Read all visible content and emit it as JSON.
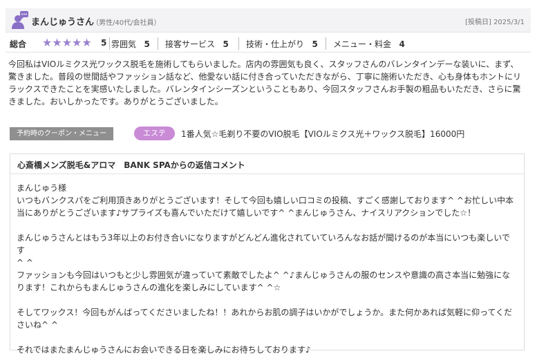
{
  "header": {
    "username": "まんじゅうさん",
    "user_attributes": "（男性/40代/会社員）",
    "posted_label": "[投稿日] 2025/3/1"
  },
  "ratings": {
    "overall_label": "総合",
    "overall_value": "5",
    "overall_stars": "★★★★★",
    "items": [
      {
        "label": "雰囲気",
        "value": "5"
      },
      {
        "label": "接客サービス",
        "value": "5"
      },
      {
        "label": "技術・仕上がり",
        "value": "5"
      },
      {
        "label": "メニュー・料金",
        "value": "4"
      }
    ]
  },
  "review": {
    "lines": [
      "今回私はVIOルミクス光ワックス脱毛を施術してもらいました。店内の雰囲気も良く、スタッフさんのバレンタインデーな装いに、まず、",
      "驚きました。普段の世間話やファッション話など、他愛ない話に付き合っていただきながら、丁寧に施術いただき、心も身体もホントにリ",
      "ラックスできたことを実感いたしました。バレンタインシーズンということもあり、今回スタッフさんお手製の粗品もいただき、さらに驚",
      "きました。おいしかったです。ありがとうございました。"
    ]
  },
  "coupon": {
    "section_label": "予約時のクーポン・メニュー",
    "tag": "エステ",
    "text": "1番人気☆毛剃り不要のVIO脱毛【VIOルミクス光＋ワックス脱毛】16000円"
  },
  "reply": {
    "title": "心斎橋メンズ脱毛&アロマ　BANK SPAからの返信コメント",
    "lines": [
      "まんじゅう様",
      "いつもバンクスパをご利用頂きありがとうございます！そして今回も嬉しい口コミの投稿、すごく感謝しております^ ^お忙しい中本",
      "当にありがとうございます♪サプライズも喜んでいただけて嬉しいです^ ^まんじゅうさん、ナイスリアクションでした☆！",
      "",
      "まんじゅうさんとはもう3年以上のお付き合いになりますがどんどん進化されていていろんなお話が聞けるのが本当にいつも楽しいです",
      "^ ^",
      "ファッションも今回はいつもと少し雰囲気が違っていて素敵でしたよ^ ^♪まんじゅうさんの服のセンスや意識の高さ本当に勉強にな",
      "ります！これからもまんじゅうさんの進化を楽しみにしています^ ^☆",
      "",
      "そしてワックス！今回もがんばってくださいましたね！！あれからお肌の調子はいかがでしょうか。また何かあれば気軽に仰ってくだ",
      "さいね^ ^",
      "",
      "それではまたまんじゅうさんにお会いできる日を楽しみにお待ちしております♪"
    ]
  },
  "colors": {
    "accent": "#9a82cf",
    "tag": "#c98ad6",
    "label_gray": "#8f8f8f"
  },
  "icons": {
    "avatar": "user-avatar-icon"
  }
}
